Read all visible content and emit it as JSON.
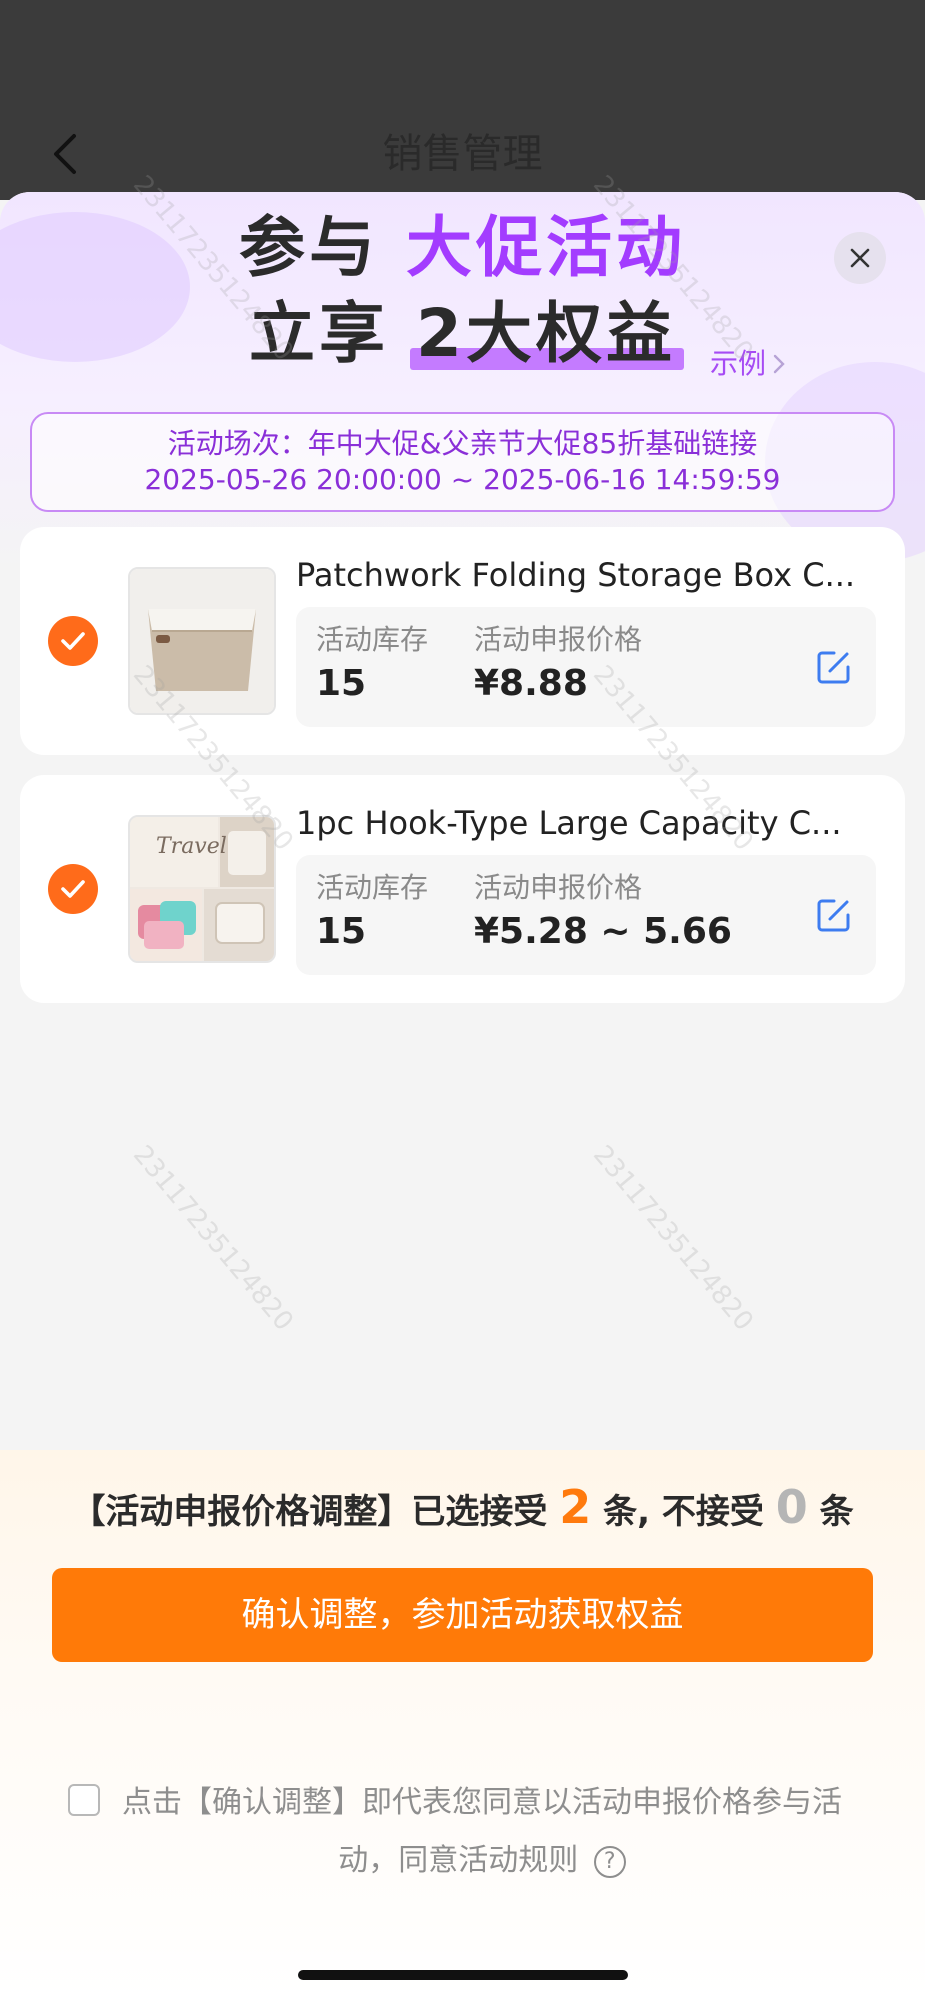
{
  "page": {
    "title": "销售管理",
    "back_icon": "chevron-left-icon"
  },
  "sheet": {
    "headline_line1_part1": "参与",
    "headline_line1_part2": "大促活动",
    "headline_line2_part1": "立享",
    "headline_line2_part2": "2大权益",
    "example_label": "示例",
    "close_icon": "close-icon",
    "event_line1": "活动场次：年中大促&父亲节大促85折基础链接",
    "event_line2": "2025-05-26 20:00:00 ~ 2025-06-16 14:59:59"
  },
  "products": [
    {
      "title": "Patchwork Folding Storage Box C...",
      "selected": true,
      "stock_label": "活动库存",
      "stock": "15",
      "price_label": "活动申报价格",
      "price": "¥8.88"
    },
    {
      "title": "1pc Hook-Type Large Capacity C...",
      "selected": true,
      "stock_label": "活动库存",
      "stock": "15",
      "price_label": "活动申报价格",
      "price": "¥5.28 ~ 5.66",
      "thumb_text": "Travel"
    }
  ],
  "footer": {
    "summary_prefix": "【活动申报价格调整】已选接受",
    "accept_count": "2",
    "summary_mid": "条, 不接受",
    "reject_count": "0",
    "summary_suffix": "条",
    "confirm_label": "确认调整，参加活动获取权益",
    "agreement_text": "点击【确认调整】即代表您同意以活动申报价格参与活动，同意活动规则",
    "agreement_checked": false
  },
  "watermark": "23117235124820",
  "colors": {
    "accent_orange": "#ff7a08",
    "accent_purple": "#a33cff",
    "edit_blue": "#3d7cf0"
  }
}
